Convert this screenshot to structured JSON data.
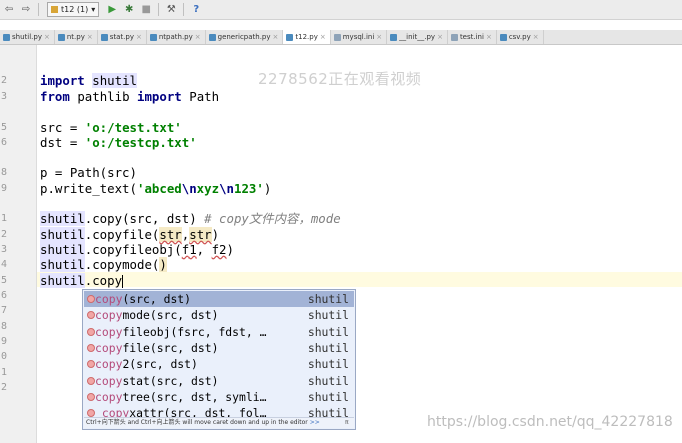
{
  "toolbar": {
    "run_config": "t12 (1)"
  },
  "tabs": [
    {
      "label": "shutil.py",
      "type": "py"
    },
    {
      "label": "nt.py",
      "type": "py"
    },
    {
      "label": "stat.py",
      "type": "py"
    },
    {
      "label": "ntpath.py",
      "type": "py"
    },
    {
      "label": "genericpath.py",
      "type": "py"
    },
    {
      "label": "t12.py",
      "type": "py",
      "active": true
    },
    {
      "label": "mysql.ini",
      "type": "ini"
    },
    {
      "label": "__init__.py",
      "type": "py"
    },
    {
      "label": "test.ini",
      "type": "ini"
    },
    {
      "label": "csv.py",
      "type": "py"
    }
  ],
  "watermark": "2278562正在观看视频",
  "footer_watermark": "https://blog.csdn.net/qq_42227818",
  "line_numbers": [
    "2",
    "3",
    "",
    "5",
    "6",
    "",
    "8",
    "9",
    "",
    "1",
    "2",
    "3",
    "4",
    "5",
    "6",
    "7",
    "8",
    "9",
    "0",
    "1",
    "2"
  ],
  "code": {
    "l1": [
      "import",
      "shutil"
    ],
    "l2": [
      "from",
      "pathlib",
      "import",
      "Path"
    ],
    "l3": [
      "src = ",
      "'o:/test.txt'"
    ],
    "l4": [
      "dst = ",
      "'o:/testcp.txt'"
    ],
    "l5": "p = Path(src)",
    "l6": [
      "p.write_text(",
      "'abced",
      "\\n",
      "xyz",
      "\\n",
      "123'",
      ")"
    ],
    "l7": [
      "shutil",
      ".copy(src, dst) ",
      "# copy文件内容，mode"
    ],
    "l8": [
      "shutil",
      ".copyfile(",
      "str",
      ",",
      "str",
      ")"
    ],
    "l9": [
      "shutil",
      ".copyfileobj(",
      "f1",
      ", ",
      "f2",
      ")"
    ],
    "l10": [
      "shutil",
      ".copymode(",
      ")"
    ],
    "l11": [
      "shutil",
      ".copy"
    ]
  },
  "completion": {
    "items": [
      {
        "match": "copy",
        "rest": "(src, dst)",
        "module": "shutil"
      },
      {
        "match": "copy",
        "rest": "mode(src, dst)",
        "module": "shutil"
      },
      {
        "match": "copy",
        "rest": "fileobj(fsrc, fdst, …",
        "module": "shutil"
      },
      {
        "match": "copy",
        "rest": "file(src, dst)",
        "module": "shutil"
      },
      {
        "match": "copy",
        "rest": "2(src, dst)",
        "module": "shutil"
      },
      {
        "match": "copy",
        "rest": "stat(src, dst)",
        "module": "shutil"
      },
      {
        "match": "copy",
        "rest": "tree(src, dst, symli…",
        "module": "shutil"
      },
      {
        "match": "_copy",
        "rest": "xattr(src, dst, fol…",
        "module": "shutil"
      }
    ],
    "status": "Ctrl+向下箭头 and Ctrl+向上箭头 will move caret down and up in the editor",
    "status_link": ">>"
  }
}
